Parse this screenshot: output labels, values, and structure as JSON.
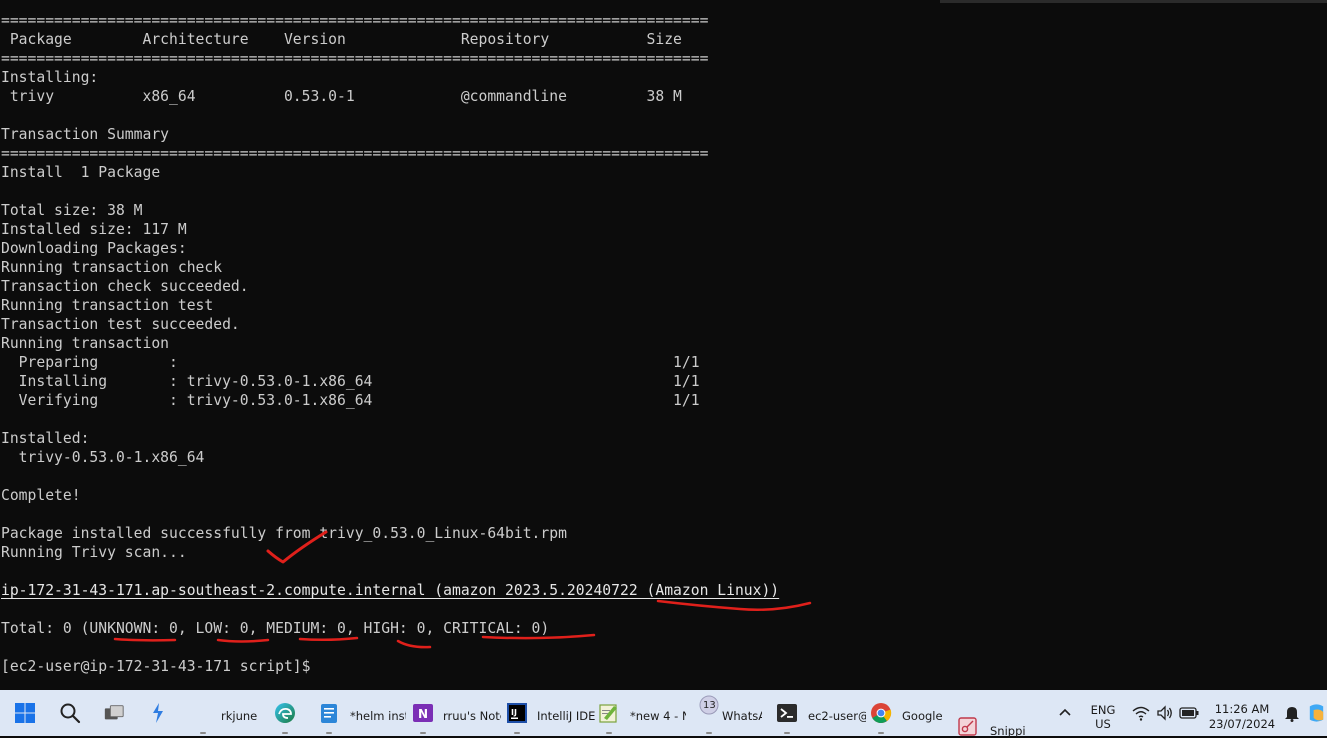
{
  "terminal": {
    "lines": [
      "================================================================================",
      " Package        Architecture    Version             Repository           Size",
      "================================================================================",
      "Installing:",
      " trivy          x86_64          0.53.0-1            @commandline         38 M",
      "",
      "Transaction Summary",
      "================================================================================",
      "Install  1 Package",
      "",
      "Total size: 38 M",
      "Installed size: 117 M",
      "Downloading Packages:",
      "Running transaction check",
      "Transaction check succeeded.",
      "Running transaction test",
      "Transaction test succeeded.",
      "Running transaction",
      "  Preparing        :                                                        1/1",
      "  Installing       : trivy-0.53.0-1.x86_64                                  1/1",
      "  Verifying        : trivy-0.53.0-1.x86_64                                  1/1",
      "",
      "Installed:",
      "  trivy-0.53.0-1.x86_64",
      "",
      "Complete!",
      "",
      "Package installed successfully from trivy_0.53.0_Linux-64bit.rpm",
      "Running Trivy scan...",
      "",
      "ip-172-31-43-171.ap-southeast-2.compute.internal (amazon 2023.5.20240722 (Amazon Linux))",
      "",
      "Total: 0 (UNKNOWN: 0, LOW: 0, MEDIUM: 0, HIGH: 0, CRITICAL: 0)",
      "",
      "[ec2-user@ip-172-31-43-171 script]$ "
    ]
  },
  "annotation_color": "#e0201b",
  "taskbar": {
    "background": "#dde7f5",
    "apps": [
      {
        "name": "rkjune",
        "icon": "user-icon"
      },
      {
        "name": "",
        "icon": "edge-icon"
      },
      {
        "name": "*helm insta",
        "icon": "notepad-icon"
      },
      {
        "name": "rruu's Note",
        "icon": "onenote-icon"
      },
      {
        "name": "IntelliJ IDE.",
        "icon": "intellij-icon"
      },
      {
        "name": "*new 4 - N",
        "icon": "notepadpp-icon"
      },
      {
        "name": "WhatsA",
        "icon": "whatsapp-icon",
        "badge": "13"
      },
      {
        "name": "ec2-user@",
        "icon": "terminal-icon"
      },
      {
        "name": "Google (",
        "icon": "chrome-icon"
      },
      {
        "name": "Snippi",
        "icon": "snipping-tool-icon"
      }
    ],
    "tray": {
      "lang_top": "ENG",
      "lang_bottom": "US",
      "time": "11:26 AM",
      "date": "23/07/2024"
    }
  }
}
